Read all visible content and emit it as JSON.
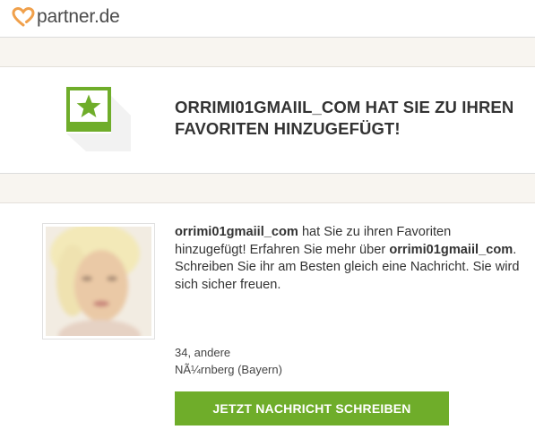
{
  "header": {
    "logo_text": "partner.de",
    "logo_icon": "heart-outline-icon",
    "accent": "#f0a04b"
  },
  "banner": {
    "icon": "favorite-star-icon",
    "title": "ORRIMI01GMAIIL_COM HAT SIE ZU IHREN FAVORITEN HINZUGEFÜGT!"
  },
  "message": {
    "username": "orrimi01gmaiil_com",
    "part1": " hat Sie zu ihren Favoriten hinzugefügt! Erfahren Sie mehr über ",
    "part2": ". Schreiben Sie ihr am Besten gleich eine Nachricht. Sie wird sich sicher freuen."
  },
  "profile": {
    "age_status": "34, andere",
    "location": "NÃ¼rnberg (Bayern)"
  },
  "cta": {
    "label": "JETZT NACHRICHT SCHREIBEN",
    "color": "#6fad2a"
  },
  "colors": {
    "star_green": "#6fad2a",
    "band": "#f8f5f0"
  }
}
